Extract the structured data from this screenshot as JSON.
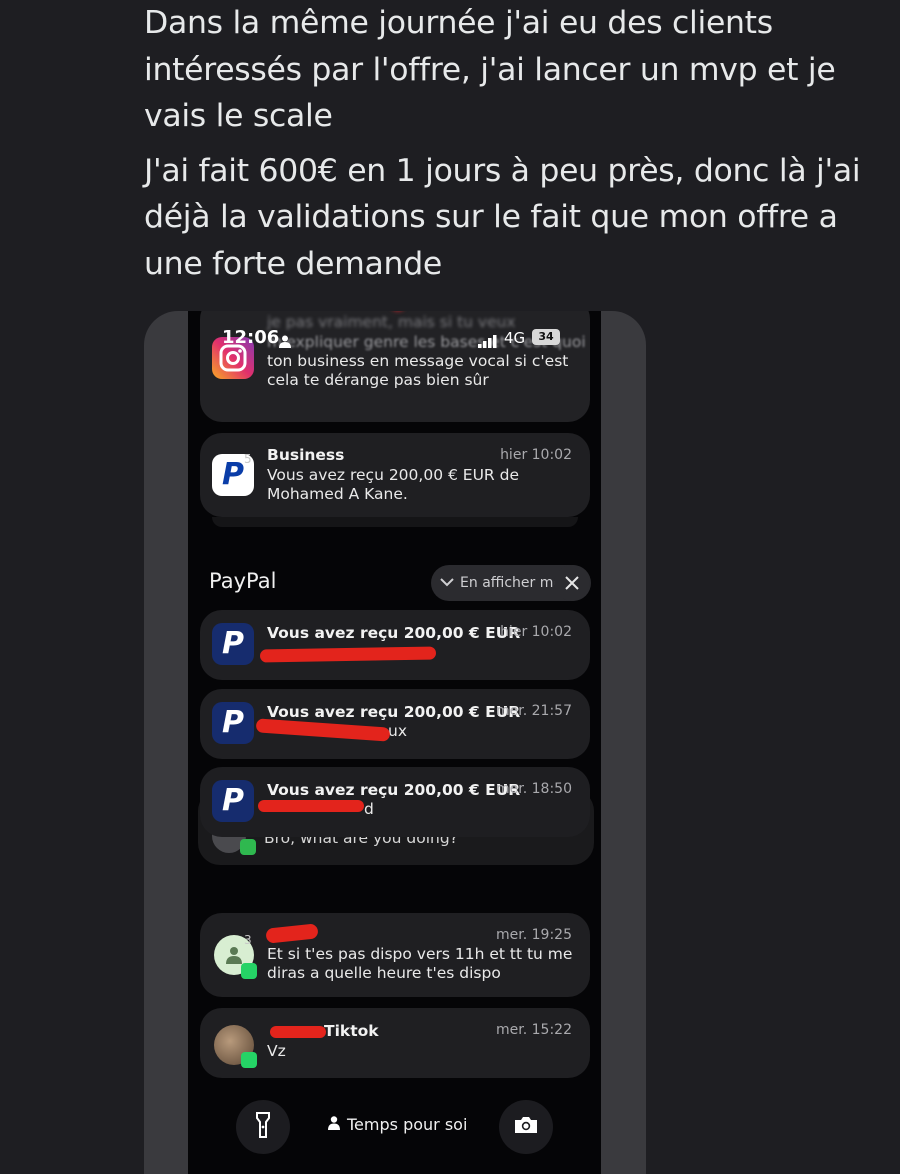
{
  "post": {
    "paragraph1": "Dans la même journée j'ai eu des clients intéressés par l'offre, j'ai lancer un mvp et je vais le scale",
    "paragraph2": "J'ai fait 600€ en 1 jours à peu près, donc là j'ai déjà la validations sur le fait que mon offre a une forte demande"
  },
  "status_bar": {
    "time": "12:06",
    "network": "4G",
    "battery": "34"
  },
  "instagram_notification": {
    "icon": "instagram-icon",
    "line_blurred_top": "je pas vraiment, mais si tu veux",
    "line_blurred": "m'expliquer genre les bases et c'est quoi",
    "line2": "ton business en message vocal si c'est",
    "line3": "cela te dérange pas bien sûr"
  },
  "business_notification": {
    "icon": "paypal-icon",
    "count": "5",
    "title": "Business",
    "time": "hier 10:02",
    "body_line1": "Vous avez reçu 200,00 € EUR de",
    "body_line2": "Mohamed A Kane."
  },
  "paypal_group": {
    "title": "PayPal",
    "collapse_label": "En afficher moins",
    "close_icon": "close-icon",
    "items": [
      {
        "title": "Vous avez reçu 200,00 € EUR",
        "time": "hier 10:02",
        "detail": ""
      },
      {
        "title": "Vous avez reçu 200,00 € EUR",
        "time": "mer. 21:57",
        "detail": "ux"
      },
      {
        "title": "Vous avez reçu 200,00 € EUR",
        "time": "mer. 18:50",
        "detail": "d"
      }
    ]
  },
  "message_notification": {
    "body": "Bro, what are you doing?"
  },
  "whatsapp_notification_1": {
    "count": "3",
    "time": "mer. 19:25",
    "body_line1": "Et si t'es pas dispo vers 11h et tt tu me",
    "body_line2": "diras a quelle heure t'es dispo"
  },
  "whatsapp_notification_2": {
    "title": "Tiktok",
    "time": "mer. 15:22",
    "body": "Vz"
  },
  "lock_controls": {
    "flashlight_icon": "flashlight-icon",
    "focus_label": "Temps pour soi",
    "camera_icon": "camera-icon"
  },
  "colors": {
    "background": "#1e1e22",
    "redaction": "#e3241c",
    "paypal": "#0a3da8",
    "whatsapp": "#25d366"
  }
}
